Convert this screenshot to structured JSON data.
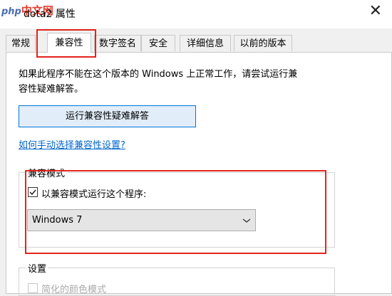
{
  "window": {
    "title": "dota2 属性",
    "watermark": {
      "php": "php",
      "cn": "中文网"
    }
  },
  "tabs": [
    {
      "label": "常规"
    },
    {
      "label": "兼容性",
      "active": true
    },
    {
      "label": "数字签名"
    },
    {
      "label": "安全"
    },
    {
      "label": "详细信息"
    },
    {
      "label": "以前的版本"
    }
  ],
  "compat": {
    "description_line1": "如果此程序不能在这个版本的 Windows 上正常工作，请尝试运行兼",
    "description_line2": "容性疑难解答。",
    "troubleshoot_button": "运行兼容性疑难解答",
    "manual_link": "如何手动选择兼容性设置?",
    "mode_group": {
      "legend": "兼容模式",
      "checkbox_label": "以兼容模式运行这个程序:",
      "checked": true,
      "selected_os": "Windows 7"
    },
    "settings_group": {
      "legend": "设置",
      "first_option": "简化的颜色模式"
    }
  },
  "colors": {
    "highlight": "#e3241b",
    "link": "#0066cc",
    "button_border": "#0078d7",
    "button_bg": "#e1edf9"
  }
}
